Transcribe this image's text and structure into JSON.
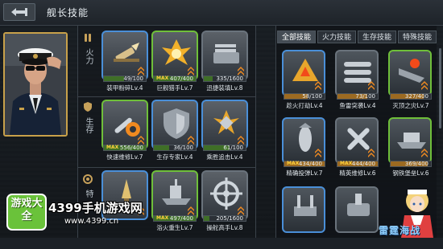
{
  "header": {
    "title": "舰长技能",
    "back_icon": "back-arrow-icon"
  },
  "categories": [
    {
      "label": "火力",
      "icon": "fire-shell-icon"
    },
    {
      "label": "生存",
      "icon": "shield-icon"
    },
    {
      "label": "特",
      "icon": "star-icon"
    }
  ],
  "captain_skills": [
    {
      "name": "装甲粉碎Lv.4",
      "progress_text": "49/100",
      "progress": 0.49,
      "max": false,
      "frame": "blue",
      "icon": "armor-piercing-shell-icon"
    },
    {
      "name": "巨舰猎手Lv.7",
      "progress_text": "407/400",
      "progress": 1.0,
      "max": true,
      "frame": "green",
      "icon": "explosion-icon"
    },
    {
      "name": "迅捷装填Lv.8",
      "progress_text": "335/1600",
      "progress": 0.21,
      "max": false,
      "frame": "gray",
      "icon": "gun-turret-icon"
    },
    {
      "name": "快速维修Lv.7",
      "progress_text": "556/400",
      "progress": 1.0,
      "max": true,
      "frame": "green",
      "icon": "repair-wrench-icon"
    },
    {
      "name": "生存专家Lv.4",
      "progress_text": "36/100",
      "progress": 0.36,
      "max": false,
      "frame": "blue",
      "icon": "shield-icon"
    },
    {
      "name": "乘胜追击Lv.4",
      "progress_text": "61/100",
      "progress": 0.61,
      "max": false,
      "frame": "blue",
      "icon": "bomb-icon"
    },
    {
      "name": "",
      "progress_text": "",
      "progress": 0.5,
      "max": false,
      "frame": "blue",
      "icon": "rocket-icon"
    },
    {
      "name": "浴火重生Lv.7",
      "progress_text": "497/400",
      "progress": 1.0,
      "max": true,
      "frame": "green",
      "icon": "battleship-icon"
    },
    {
      "name": "操舵高手Lv.8",
      "progress_text": "205/1600",
      "progress": 0.13,
      "max": false,
      "frame": "gray",
      "icon": "ship-wheel-icon"
    }
  ],
  "tabs": [
    {
      "label": "全部技能",
      "active": true
    },
    {
      "label": "火力技能",
      "active": false
    },
    {
      "label": "生存技能",
      "active": false
    },
    {
      "label": "特殊技能",
      "active": false
    }
  ],
  "all_skills": [
    {
      "name": "趁火打劫Lv.4",
      "progress_text": "58/100",
      "progress": 0.58,
      "max": false,
      "frame": "blue",
      "icon": "fire-warning-icon"
    },
    {
      "name": "鱼雷突袭Lv.4",
      "progress_text": "73/100",
      "progress": 0.73,
      "max": false,
      "frame": "gray",
      "icon": "torpedo-icon"
    },
    {
      "name": "灭顶之灾Lv.7",
      "progress_text": "327/400",
      "progress": 0.82,
      "max": false,
      "frame": "green",
      "icon": "sinking-ship-icon"
    },
    {
      "name": "精确投弹Lv.7",
      "progress_text": "434/400",
      "progress": 1.0,
      "max": true,
      "frame": "blue",
      "icon": "aerial-bomb-icon"
    },
    {
      "name": "精英维修Lv.6",
      "progress_text": "444/400",
      "progress": 1.0,
      "max": true,
      "frame": "gray",
      "icon": "crossed-wrench-icon"
    },
    {
      "name": "钢铁堡垒Lv.6",
      "progress_text": "369/400",
      "progress": 0.92,
      "max": false,
      "frame": "green",
      "icon": "fortress-ship-icon"
    },
    {
      "name": "",
      "progress_text": "",
      "progress": 0,
      "max": false,
      "frame": "blue",
      "icon": "anti-air-gun-icon"
    },
    {
      "name": "",
      "progress_text": "",
      "progress": 0,
      "max": false,
      "frame": "gray",
      "icon": "naval-cannon-icon"
    }
  ],
  "max_label": "MAX",
  "watermark": {
    "logo_text": "游戏大全",
    "site": "4399手机游戏网",
    "url": "www.4399.cn",
    "game_logo": "雷霆海战"
  }
}
